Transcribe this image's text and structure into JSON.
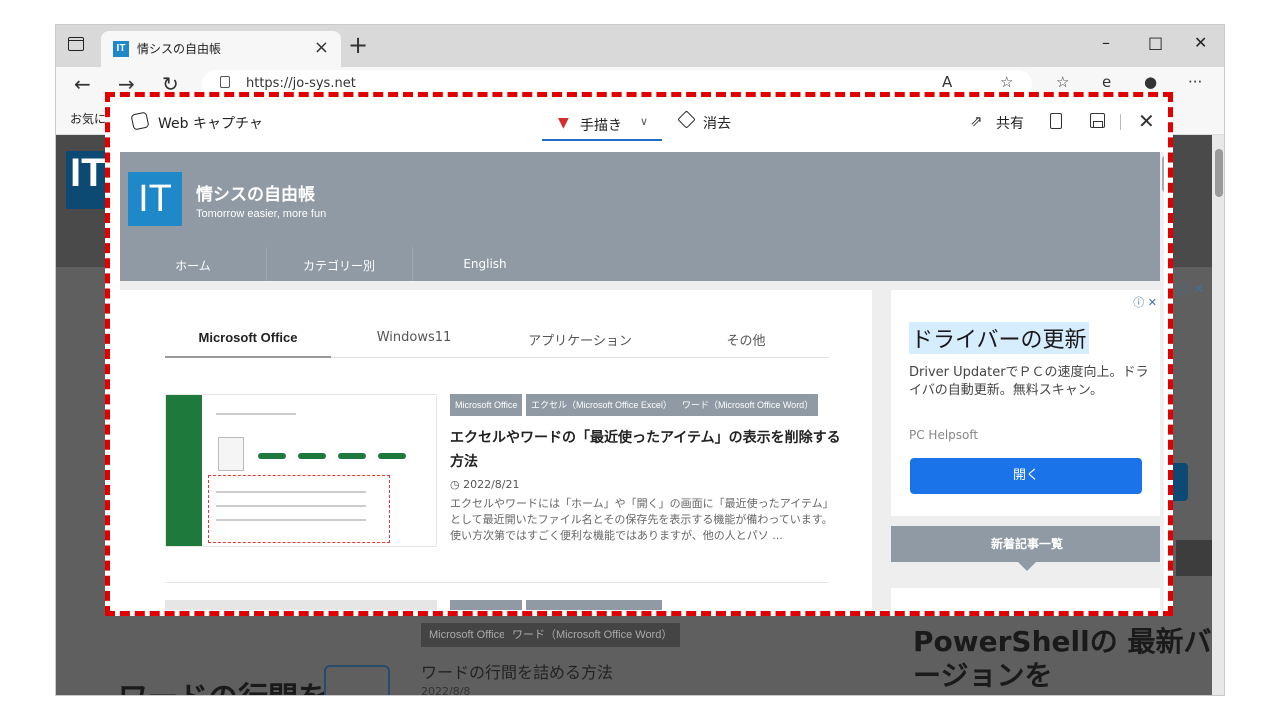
{
  "browser": {
    "tab_title": "情シスの自由帳",
    "tab_favicon": "IT",
    "url": "https://jo-sys.net",
    "favorites_label": "お気に入",
    "window_controls": [
      "–",
      "□",
      "✕"
    ]
  },
  "capture": {
    "title": "Web キャプチャ",
    "draw_label": "手描き",
    "erase_label": "消去",
    "share_label": "共有",
    "accent_color": "#e00000"
  },
  "site": {
    "logo": "IT",
    "name": "情シスの自由帳",
    "tagline": "Tomorrow easier, more fun",
    "nav": [
      "ホーム",
      "カテゴリー別",
      "English"
    ],
    "category_tabs": [
      "Microsoft Office",
      "Windows11",
      "アプリケーション",
      "その他"
    ],
    "article": {
      "tags": [
        "Microsoft Office",
        "エクセル（Microsoft Office Excel）",
        "ワード（Microsoft Office Word）"
      ],
      "title": "エクセルやワードの「最近使ったアイテム」の表示を削除する方法",
      "date": "2022/8/21",
      "excerpt": "エクセルやワードには「ホーム」や「開く」の画面に「最近使ったアイテム」として最近開いたファイル名とその保存先を表示する機能が備わっています。 使い方次第ではすごく便利な機能ではありますが、他の人とパソ ..."
    },
    "ad": {
      "title": "ドライバーの更新",
      "text": "Driver UpdaterでＰＣの速度向上。ドライバの自動更新。無料スキャン。",
      "brand": "PC Helpsoft",
      "button": "開く",
      "info": "ⓘ ✕"
    },
    "news_heading": "新着記事一覧"
  },
  "background": {
    "logo": "IT",
    "tags": [
      "Microsoft Office",
      "ワード（Microsoft Office Word）"
    ],
    "title": "ワードの行間を詰める方法",
    "date": "2022/8/8",
    "heading": "ワードの行間を",
    "ps_heading": "PowerShellの 最新バージョンを",
    "ad_info": "ⓘ ✕"
  }
}
